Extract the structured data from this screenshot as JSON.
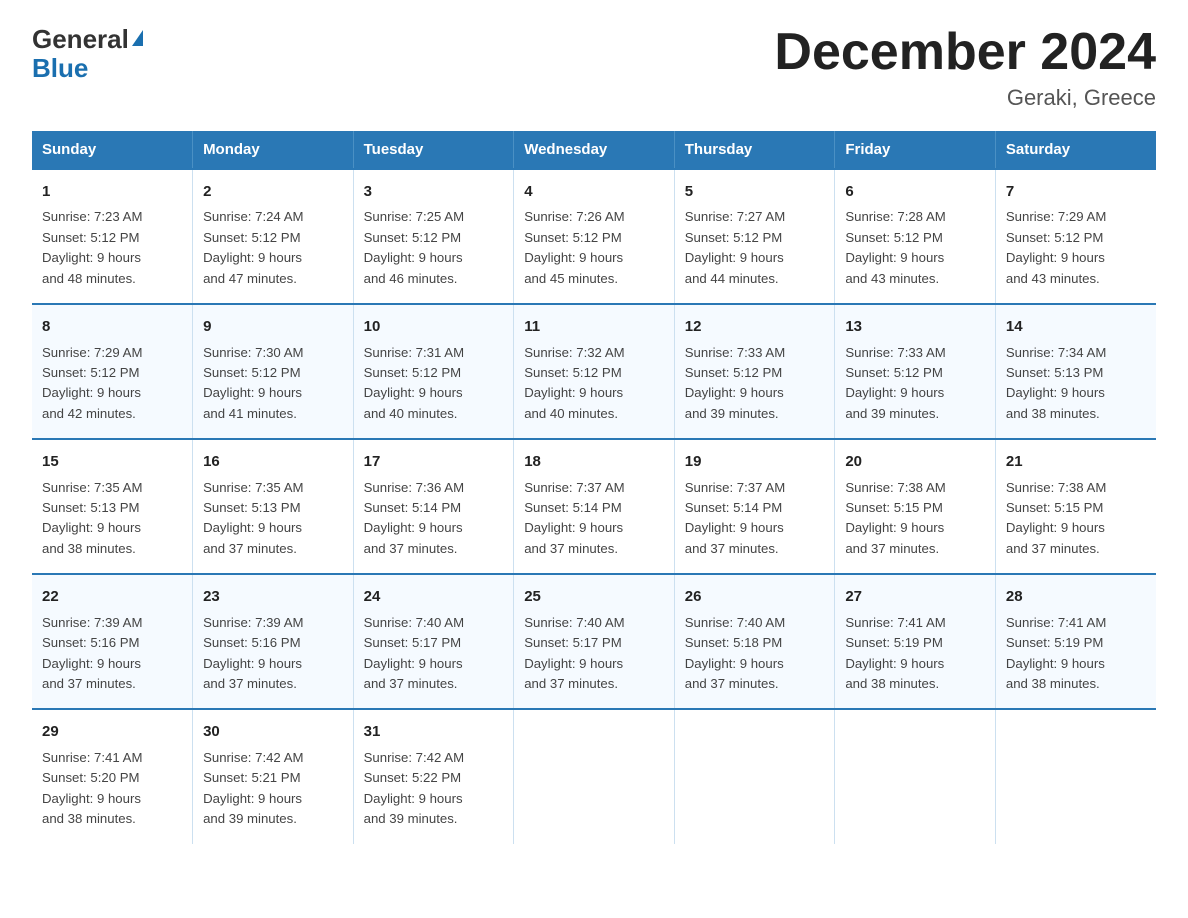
{
  "logo": {
    "line1": "General",
    "line2": "Blue"
  },
  "title": "December 2024",
  "subtitle": "Geraki, Greece",
  "days_header": [
    "Sunday",
    "Monday",
    "Tuesday",
    "Wednesday",
    "Thursday",
    "Friday",
    "Saturday"
  ],
  "weeks": [
    [
      {
        "day": "1",
        "sunrise": "7:23 AM",
        "sunset": "5:12 PM",
        "daylight": "9 hours and 48 minutes."
      },
      {
        "day": "2",
        "sunrise": "7:24 AM",
        "sunset": "5:12 PM",
        "daylight": "9 hours and 47 minutes."
      },
      {
        "day": "3",
        "sunrise": "7:25 AM",
        "sunset": "5:12 PM",
        "daylight": "9 hours and 46 minutes."
      },
      {
        "day": "4",
        "sunrise": "7:26 AM",
        "sunset": "5:12 PM",
        "daylight": "9 hours and 45 minutes."
      },
      {
        "day": "5",
        "sunrise": "7:27 AM",
        "sunset": "5:12 PM",
        "daylight": "9 hours and 44 minutes."
      },
      {
        "day": "6",
        "sunrise": "7:28 AM",
        "sunset": "5:12 PM",
        "daylight": "9 hours and 43 minutes."
      },
      {
        "day": "7",
        "sunrise": "7:29 AM",
        "sunset": "5:12 PM",
        "daylight": "9 hours and 43 minutes."
      }
    ],
    [
      {
        "day": "8",
        "sunrise": "7:29 AM",
        "sunset": "5:12 PM",
        "daylight": "9 hours and 42 minutes."
      },
      {
        "day": "9",
        "sunrise": "7:30 AM",
        "sunset": "5:12 PM",
        "daylight": "9 hours and 41 minutes."
      },
      {
        "day": "10",
        "sunrise": "7:31 AM",
        "sunset": "5:12 PM",
        "daylight": "9 hours and 40 minutes."
      },
      {
        "day": "11",
        "sunrise": "7:32 AM",
        "sunset": "5:12 PM",
        "daylight": "9 hours and 40 minutes."
      },
      {
        "day": "12",
        "sunrise": "7:33 AM",
        "sunset": "5:12 PM",
        "daylight": "9 hours and 39 minutes."
      },
      {
        "day": "13",
        "sunrise": "7:33 AM",
        "sunset": "5:12 PM",
        "daylight": "9 hours and 39 minutes."
      },
      {
        "day": "14",
        "sunrise": "7:34 AM",
        "sunset": "5:13 PM",
        "daylight": "9 hours and 38 minutes."
      }
    ],
    [
      {
        "day": "15",
        "sunrise": "7:35 AM",
        "sunset": "5:13 PM",
        "daylight": "9 hours and 38 minutes."
      },
      {
        "day": "16",
        "sunrise": "7:35 AM",
        "sunset": "5:13 PM",
        "daylight": "9 hours and 37 minutes."
      },
      {
        "day": "17",
        "sunrise": "7:36 AM",
        "sunset": "5:14 PM",
        "daylight": "9 hours and 37 minutes."
      },
      {
        "day": "18",
        "sunrise": "7:37 AM",
        "sunset": "5:14 PM",
        "daylight": "9 hours and 37 minutes."
      },
      {
        "day": "19",
        "sunrise": "7:37 AM",
        "sunset": "5:14 PM",
        "daylight": "9 hours and 37 minutes."
      },
      {
        "day": "20",
        "sunrise": "7:38 AM",
        "sunset": "5:15 PM",
        "daylight": "9 hours and 37 minutes."
      },
      {
        "day": "21",
        "sunrise": "7:38 AM",
        "sunset": "5:15 PM",
        "daylight": "9 hours and 37 minutes."
      }
    ],
    [
      {
        "day": "22",
        "sunrise": "7:39 AM",
        "sunset": "5:16 PM",
        "daylight": "9 hours and 37 minutes."
      },
      {
        "day": "23",
        "sunrise": "7:39 AM",
        "sunset": "5:16 PM",
        "daylight": "9 hours and 37 minutes."
      },
      {
        "day": "24",
        "sunrise": "7:40 AM",
        "sunset": "5:17 PM",
        "daylight": "9 hours and 37 minutes."
      },
      {
        "day": "25",
        "sunrise": "7:40 AM",
        "sunset": "5:17 PM",
        "daylight": "9 hours and 37 minutes."
      },
      {
        "day": "26",
        "sunrise": "7:40 AM",
        "sunset": "5:18 PM",
        "daylight": "9 hours and 37 minutes."
      },
      {
        "day": "27",
        "sunrise": "7:41 AM",
        "sunset": "5:19 PM",
        "daylight": "9 hours and 38 minutes."
      },
      {
        "day": "28",
        "sunrise": "7:41 AM",
        "sunset": "5:19 PM",
        "daylight": "9 hours and 38 minutes."
      }
    ],
    [
      {
        "day": "29",
        "sunrise": "7:41 AM",
        "sunset": "5:20 PM",
        "daylight": "9 hours and 38 minutes."
      },
      {
        "day": "30",
        "sunrise": "7:42 AM",
        "sunset": "5:21 PM",
        "daylight": "9 hours and 39 minutes."
      },
      {
        "day": "31",
        "sunrise": "7:42 AM",
        "sunset": "5:22 PM",
        "daylight": "9 hours and 39 minutes."
      },
      null,
      null,
      null,
      null
    ]
  ],
  "labels": {
    "sunrise": "Sunrise:",
    "sunset": "Sunset:",
    "daylight": "Daylight:"
  }
}
